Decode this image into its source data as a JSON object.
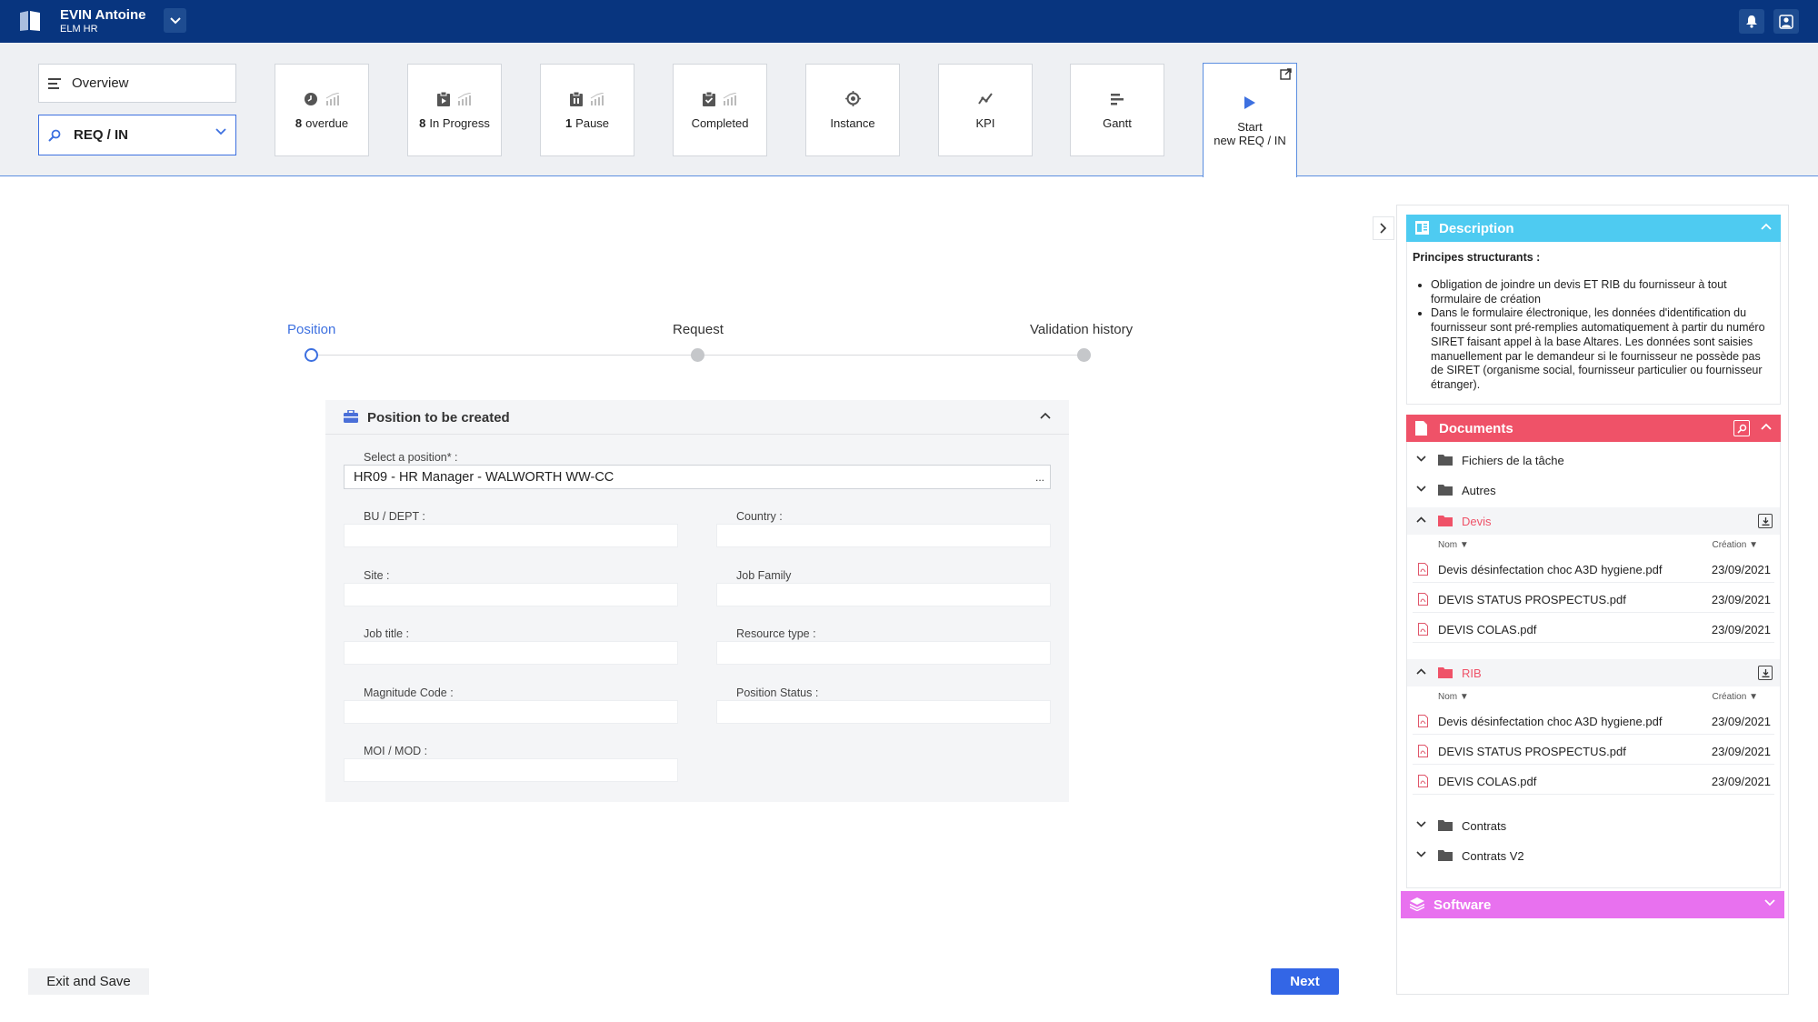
{
  "topbar": {
    "user_name": "EVIN Antoine",
    "user_org": "ELM HR",
    "icons": [
      "book-icon",
      "chevron-down-icon",
      "bell-icon",
      "user-icon"
    ],
    "background": "#08357f"
  },
  "header": {
    "overview_label": "Overview",
    "selector_value": "REQ / IN",
    "tiles": [
      {
        "count": "8",
        "label": "overdue",
        "icon": "clock-icon"
      },
      {
        "count": "8",
        "label": "In Progress",
        "icon": "clipboard-play-icon"
      },
      {
        "count": "1",
        "label": "Pause",
        "icon": "clipboard-pause-icon"
      },
      {
        "count": "",
        "label": "Completed",
        "icon": "clipboard-check-icon"
      },
      {
        "count": "",
        "label": "Instance",
        "icon": "target-icon"
      },
      {
        "count": "",
        "label": "KPI",
        "icon": "trend-icon"
      },
      {
        "count": "",
        "label": "Gantt",
        "icon": "gantt-icon"
      }
    ],
    "start_line1": "Start",
    "start_line2": "new REQ / IN"
  },
  "stepper": {
    "steps": [
      "Position",
      "Request",
      "Validation history"
    ],
    "active": 0
  },
  "form": {
    "title": "Position to be created",
    "position_label": "Select a position* :",
    "position_value": "HR09 - HR Manager - WALWORTH WW-CC",
    "dots": "...",
    "fields": {
      "bu_dept": "BU / DEPT :",
      "country": "Country :",
      "site": "Site :",
      "job_family": "Job Family",
      "job_title": "Job title :",
      "resource_type": "Resource type :",
      "magnitude_code": "Magnitude Code :",
      "position_status": "Position Status :",
      "moi_mod": "MOI / MOD :"
    }
  },
  "actions": {
    "exit_label": "Exit and Save",
    "next_label": "Next"
  },
  "description": {
    "title": "Description",
    "principles_title": "Principes structurants :",
    "bullets": [
      "Obligation de joindre un devis ET RIB du fournisseur à tout formulaire de création",
      "Dans le formulaire électronique, les données d'identification du fournisseur sont pré-remplies automatiquement à partir du numéro SIRET faisant  appel à la base Altares. Les données sont saisies manuellement par le demandeur si le fournisseur ne possède pas de SIRET (organisme social, fournisseur particulier ou fournisseur étranger)."
    ],
    "color": "#4ecbf1"
  },
  "documents": {
    "title": "Documents",
    "color": "#ef5268",
    "col_name": "Nom",
    "col_created": "Création",
    "folders": {
      "f1": "Fichiers de la tâche",
      "f2": "Autres",
      "devis": "Devis",
      "rib": "RIB",
      "contrats": "Contrats",
      "contrats_v2": "Contrats V2"
    },
    "devis_files": [
      {
        "name": "Devis désinfectation choc A3D hygiene.pdf",
        "date": "23/09/2021"
      },
      {
        "name": "DEVIS STATUS PROSPECTUS.pdf",
        "date": "23/09/2021"
      },
      {
        "name": "DEVIS COLAS.pdf",
        "date": "23/09/2021"
      }
    ],
    "rib_files": [
      {
        "name": "Devis désinfectation choc A3D hygiene.pdf",
        "date": "23/09/2021"
      },
      {
        "name": "DEVIS STATUS PROSPECTUS.pdf",
        "date": "23/09/2021"
      },
      {
        "name": "DEVIS COLAS.pdf",
        "date": "23/09/2021"
      }
    ]
  },
  "software": {
    "title": "Software",
    "color": "#e871ef"
  }
}
